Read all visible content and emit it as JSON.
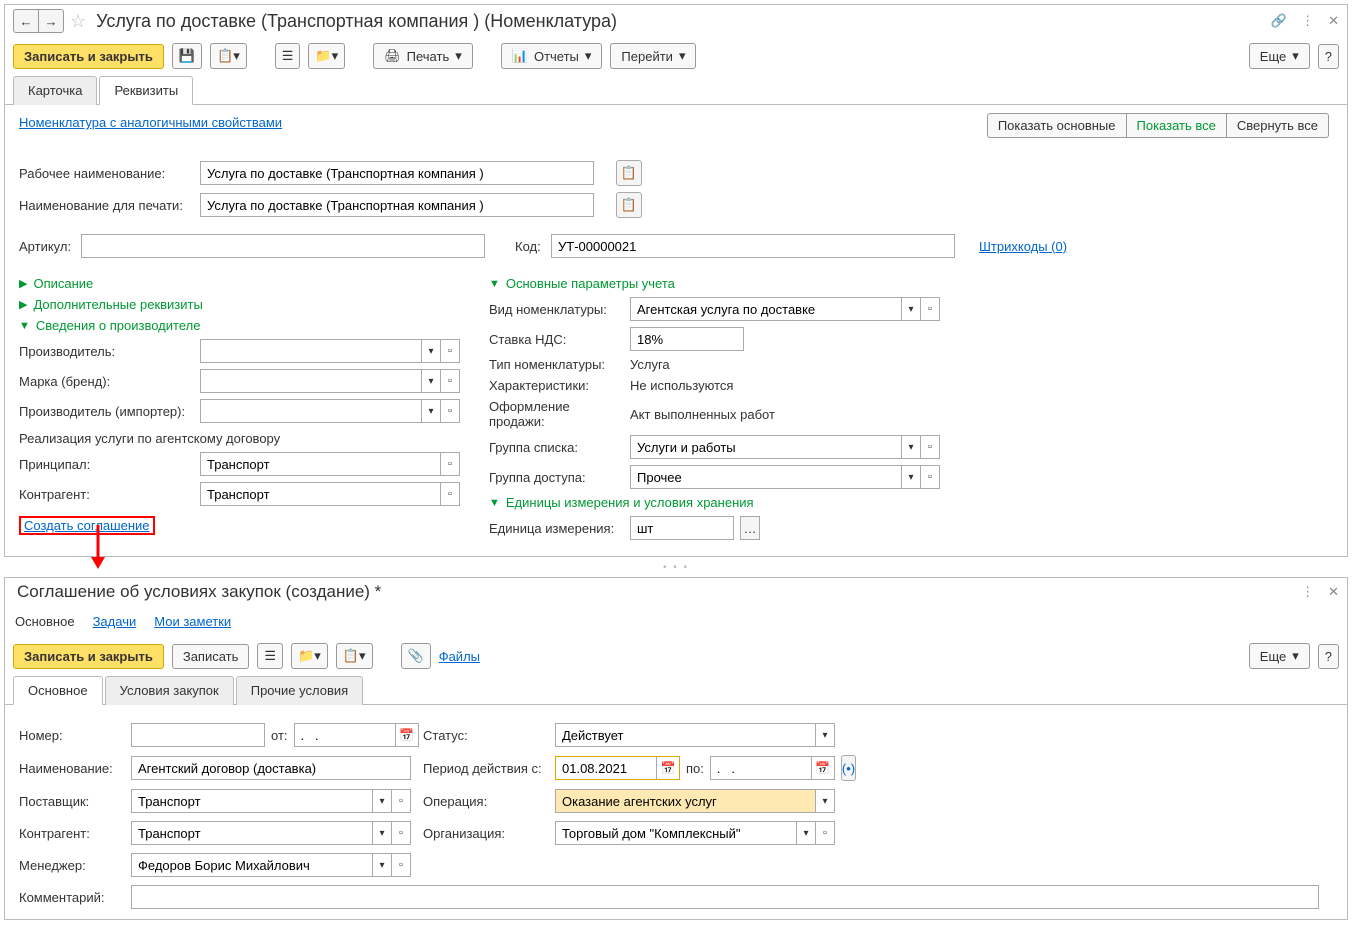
{
  "top": {
    "title": "Услуга по доставке (Транспортная компания ) (Номенклатура)",
    "toolbar": {
      "save_close": "Записать и закрыть",
      "print": "Печать",
      "reports": "Отчеты",
      "goto": "Перейти",
      "more": "Еще"
    },
    "tabs": {
      "card": "Карточка",
      "props": "Реквизиты"
    },
    "link_similar": "Номенклатура с аналогичными свойствами",
    "show_main": "Показать основные",
    "show_all": "Показать все",
    "collapse_all": "Свернуть все",
    "labels": {
      "work_name": "Рабочее наименование:",
      "print_name": "Наименование для печати:",
      "article": "Артикул:",
      "code": "Код:",
      "barcodes": "Штрихкоды (0)"
    },
    "values": {
      "work_name": "Услуга по доставке (Транспортная компания )",
      "print_name": "Услуга по доставке (Транспортная компания )",
      "code": "УТ-00000021"
    },
    "sections": {
      "description": "Описание",
      "extra": "Дополнительные реквизиты",
      "manufacturer": "Сведения о производителе",
      "main_params": "Основные параметры учета",
      "units": "Единицы измерения и условия хранения"
    },
    "left": {
      "manufacturer": "Производитель:",
      "brand": "Марка (бренд):",
      "importer": "Производитель (импортер):",
      "agency_head": "Реализация услуги по агентскому договору",
      "principal": "Принципал:",
      "counterparty": "Контрагент:",
      "principal_val": "Транспорт",
      "counterparty_val": "Транспорт",
      "create_agreement": "Создать соглашение"
    },
    "right": {
      "kind": "Вид номенклатуры:",
      "kind_val": "Агентская услуга по доставке",
      "vat": "Ставка НДС:",
      "vat_val": "18%",
      "type": "Тип номенклатуры:",
      "type_val": "Услуга",
      "char": "Характеристики:",
      "char_val": "Не используются",
      "sale": "Оформление продажи:",
      "sale_val": "Акт выполненных работ",
      "list_group": "Группа списка:",
      "list_group_val": "Услуги и работы",
      "access_group": "Группа доступа:",
      "access_group_val": "Прочее",
      "unit": "Единица измерения:",
      "unit_val": "шт"
    }
  },
  "bottom": {
    "title": "Соглашение об условиях закупок (создание) *",
    "nav": {
      "main": "Основное",
      "tasks": "Задачи",
      "notes": "Мои заметки"
    },
    "toolbar": {
      "save_close": "Записать и закрыть",
      "save": "Записать",
      "files": "Файлы",
      "more": "Еще"
    },
    "tabs": {
      "main": "Основное",
      "cond": "Условия закупок",
      "other": "Прочие условия"
    },
    "labels": {
      "number": "Номер:",
      "from": "от:",
      "status": "Статус:",
      "name": "Наименование:",
      "period_from": "Период действия с:",
      "period_to": "по:",
      "supplier": "Поставщик:",
      "operation": "Операция:",
      "counterparty": "Контрагент:",
      "organization": "Организация:",
      "manager": "Менеджер:",
      "comment": "Комментарий:"
    },
    "values": {
      "from": ".   .",
      "status": "Действует",
      "name": "Агентский договор (доставка)",
      "period_from": "01.08.2021",
      "period_to": ".   .",
      "supplier": "Транспорт",
      "operation": "Оказание агентских услуг",
      "counterparty": "Транспорт",
      "organization": "Торговый дом \"Комплексный\"",
      "manager": "Федоров Борис Михайлович"
    }
  }
}
